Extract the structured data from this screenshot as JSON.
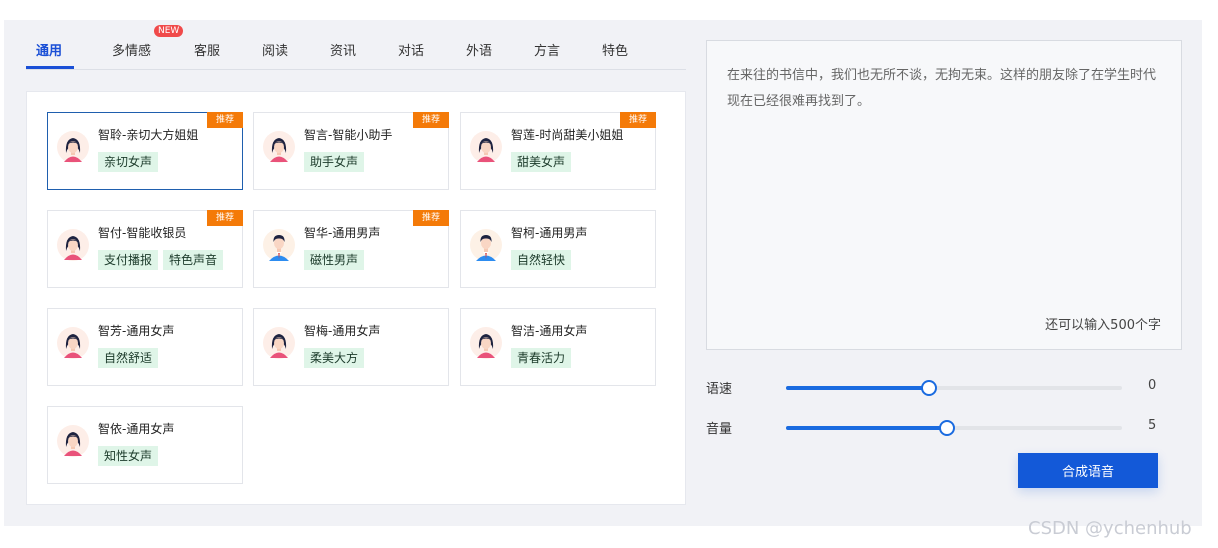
{
  "tabs": [
    {
      "label": "通用",
      "active": true
    },
    {
      "label": "多情感",
      "badge": "NEW"
    },
    {
      "label": "客服"
    },
    {
      "label": "阅读"
    },
    {
      "label": "资讯"
    },
    {
      "label": "对话"
    },
    {
      "label": "外语"
    },
    {
      "label": "方言"
    },
    {
      "label": "特色"
    }
  ],
  "recommend_label": "推荐",
  "voices": [
    {
      "name": "智聆-亲切大方姐姐",
      "tags": [
        "亲切女声"
      ],
      "recommended": true,
      "selected": true,
      "gender": "female"
    },
    {
      "name": "智言-智能小助手",
      "tags": [
        "助手女声"
      ],
      "recommended": true,
      "gender": "female"
    },
    {
      "name": "智莲-时尚甜美小姐姐",
      "tags": [
        "甜美女声"
      ],
      "recommended": true,
      "gender": "female"
    },
    {
      "name": "智付-智能收银员",
      "tags": [
        "支付播报",
        "特色声音"
      ],
      "recommended": true,
      "gender": "female"
    },
    {
      "name": "智华-通用男声",
      "tags": [
        "磁性男声"
      ],
      "recommended": true,
      "gender": "male"
    },
    {
      "name": "智柯-通用男声",
      "tags": [
        "自然轻快"
      ],
      "recommended": false,
      "gender": "male"
    },
    {
      "name": "智芳-通用女声",
      "tags": [
        "自然舒适"
      ],
      "recommended": false,
      "gender": "female"
    },
    {
      "name": "智梅-通用女声",
      "tags": [
        "柔美大方"
      ],
      "recommended": false,
      "gender": "female"
    },
    {
      "name": "智洁-通用女声",
      "tags": [
        "青春活力"
      ],
      "recommended": false,
      "gender": "female"
    },
    {
      "name": "智依-通用女声",
      "tags": [
        "知性女声"
      ],
      "recommended": false,
      "gender": "female"
    }
  ],
  "text_input": {
    "value": "在来往的书信中，我们也无所不谈，无拘无束。这样的朋友除了在学生时代现在已经很难再找到了。",
    "counter": "还可以输入500个字"
  },
  "speed": {
    "label": "语速",
    "value": "0",
    "fill_fraction": 0.425
  },
  "volume": {
    "label": "音量",
    "value": "5",
    "fill_fraction": 0.48
  },
  "synthesize_button": "合成语音",
  "watermark": "CSDN @ychenhub",
  "colors": {
    "accent": "#1359d8",
    "recommend": "#f47a08",
    "tag_bg": "#dff5e8",
    "new_badge": "#f04a4a"
  }
}
